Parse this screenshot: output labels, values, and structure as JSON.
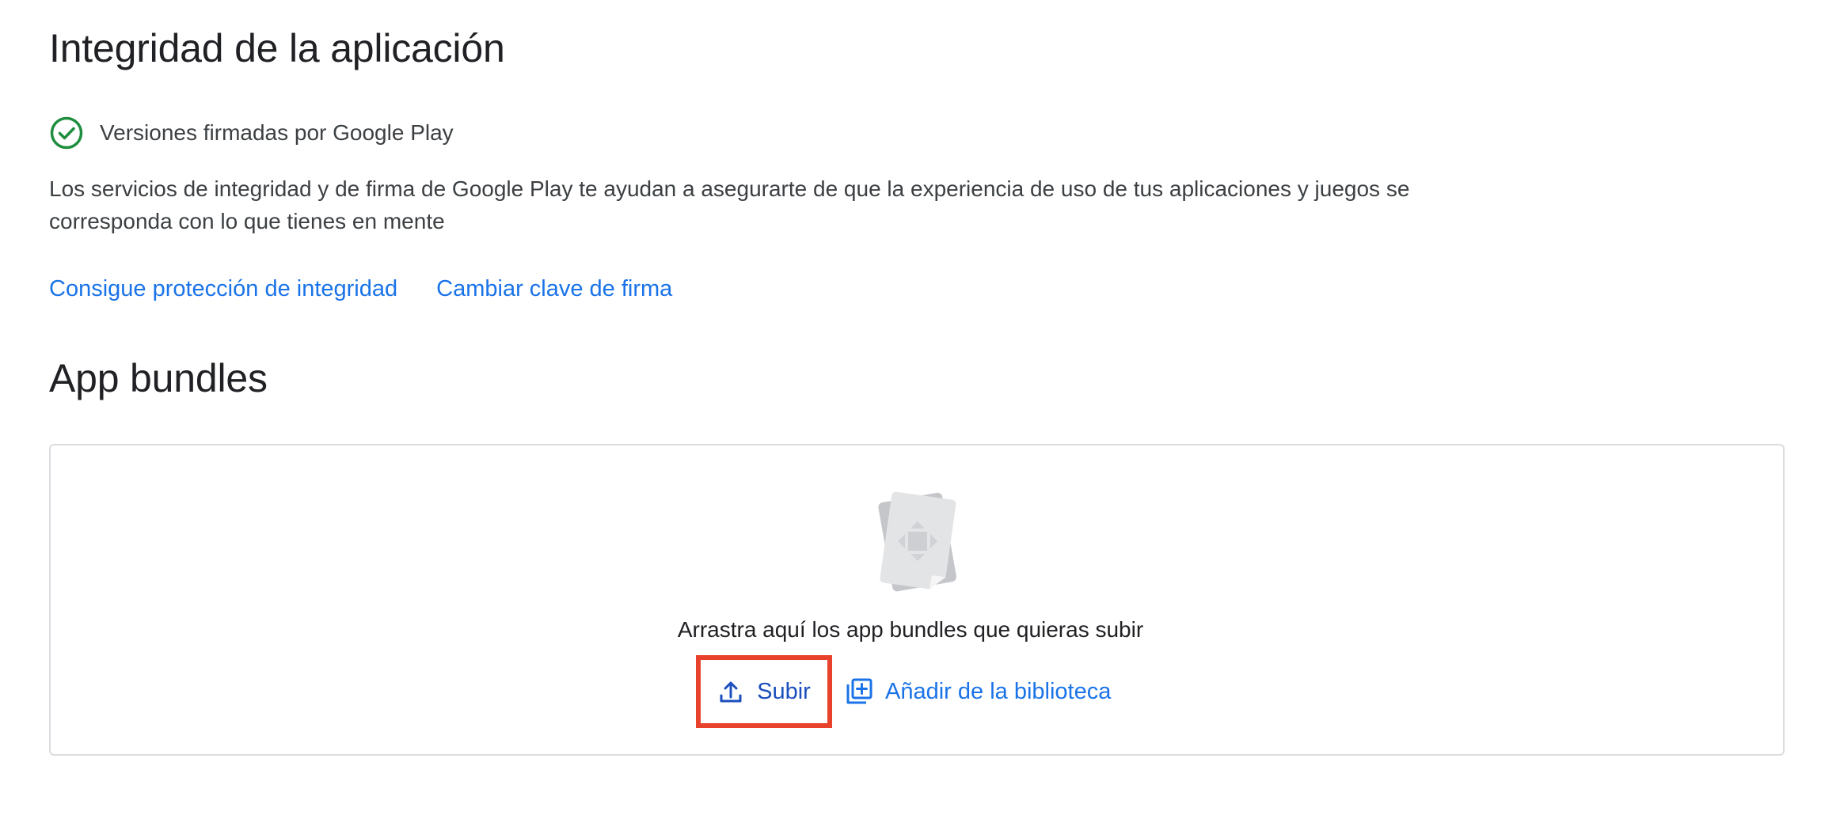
{
  "integrity": {
    "title": "Integridad de la aplicación",
    "status": {
      "icon": "check-circle-icon",
      "text": "Versiones firmadas por Google Play",
      "color": "#1e8e3e"
    },
    "description": "Los servicios de integridad y de firma de Google Play te ayudan a asegurarte de que la experiencia de uso de tus aplicaciones y juegos se corresponda con lo que tienes en mente",
    "links": {
      "protection": "Consigue protección de integridad",
      "change_key": "Cambiar clave de firma"
    }
  },
  "bundles": {
    "title": "App bundles",
    "dropzone": {
      "illustration": "app-bundle-file-icon",
      "text": "Arrastra aquí los app bundles que quieras subir",
      "upload_label": "Subir",
      "upload_icon": "upload-icon",
      "library_label": "Añadir de la biblioteca",
      "library_icon": "add-to-library-icon",
      "highlight_color": "#e8412c"
    }
  },
  "colors": {
    "link": "#1a73e8",
    "text": "#3c4043",
    "heading": "#202124",
    "border": "#dadce0"
  }
}
